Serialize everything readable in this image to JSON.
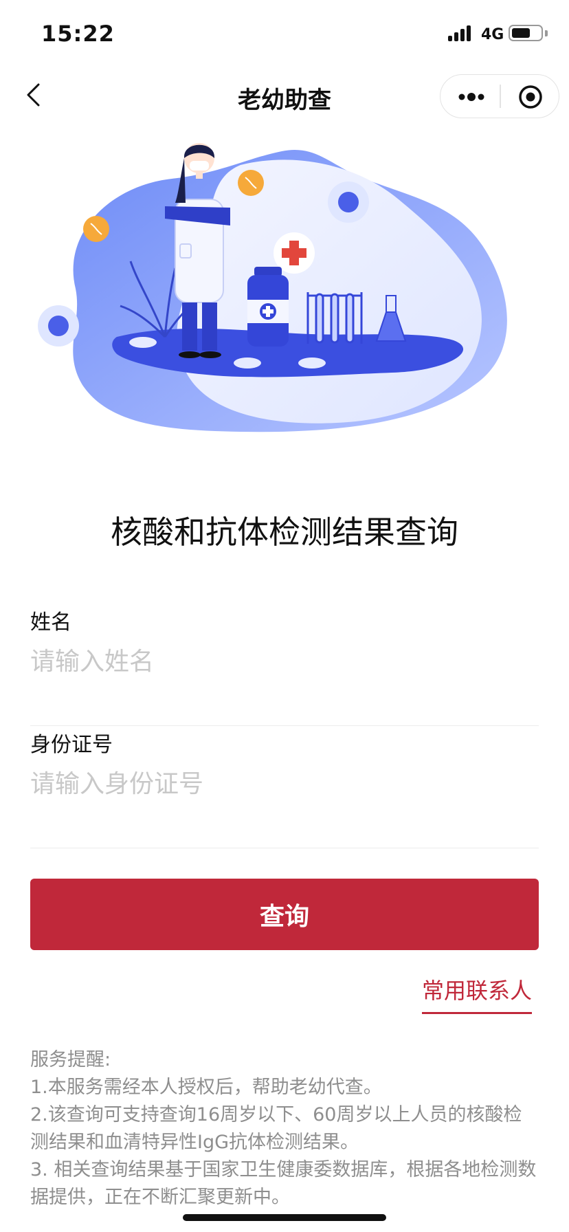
{
  "status_bar": {
    "time": "15:22",
    "network": "4G",
    "battery_level": 0.65
  },
  "nav": {
    "title": "老幼助查"
  },
  "page": {
    "title": "核酸和抗体检测结果查询"
  },
  "form": {
    "name": {
      "label": "姓名",
      "placeholder": "请输入姓名"
    },
    "id_number": {
      "label": "身份证号",
      "placeholder": "请输入身份证号"
    },
    "submit_label": "查询"
  },
  "contacts_link": "常用联系人",
  "notice": {
    "heading": "服务提醒:",
    "items": [
      "1.本服务需经本人授权后，帮助老幼代查。",
      "2.该查询可支持查询16周岁以下、60周岁以上人员的核酸检测结果和血清特异性IgG抗体检测结果。",
      "3. 相关查询结果基于国家卫生健康委数据库，根据各地检测数据提供，正在不断汇聚更新中。"
    ]
  },
  "colors": {
    "accent": "#c0283a",
    "illustration_blue": "#4a5fe8",
    "illustration_light": "#c9d3ff"
  }
}
